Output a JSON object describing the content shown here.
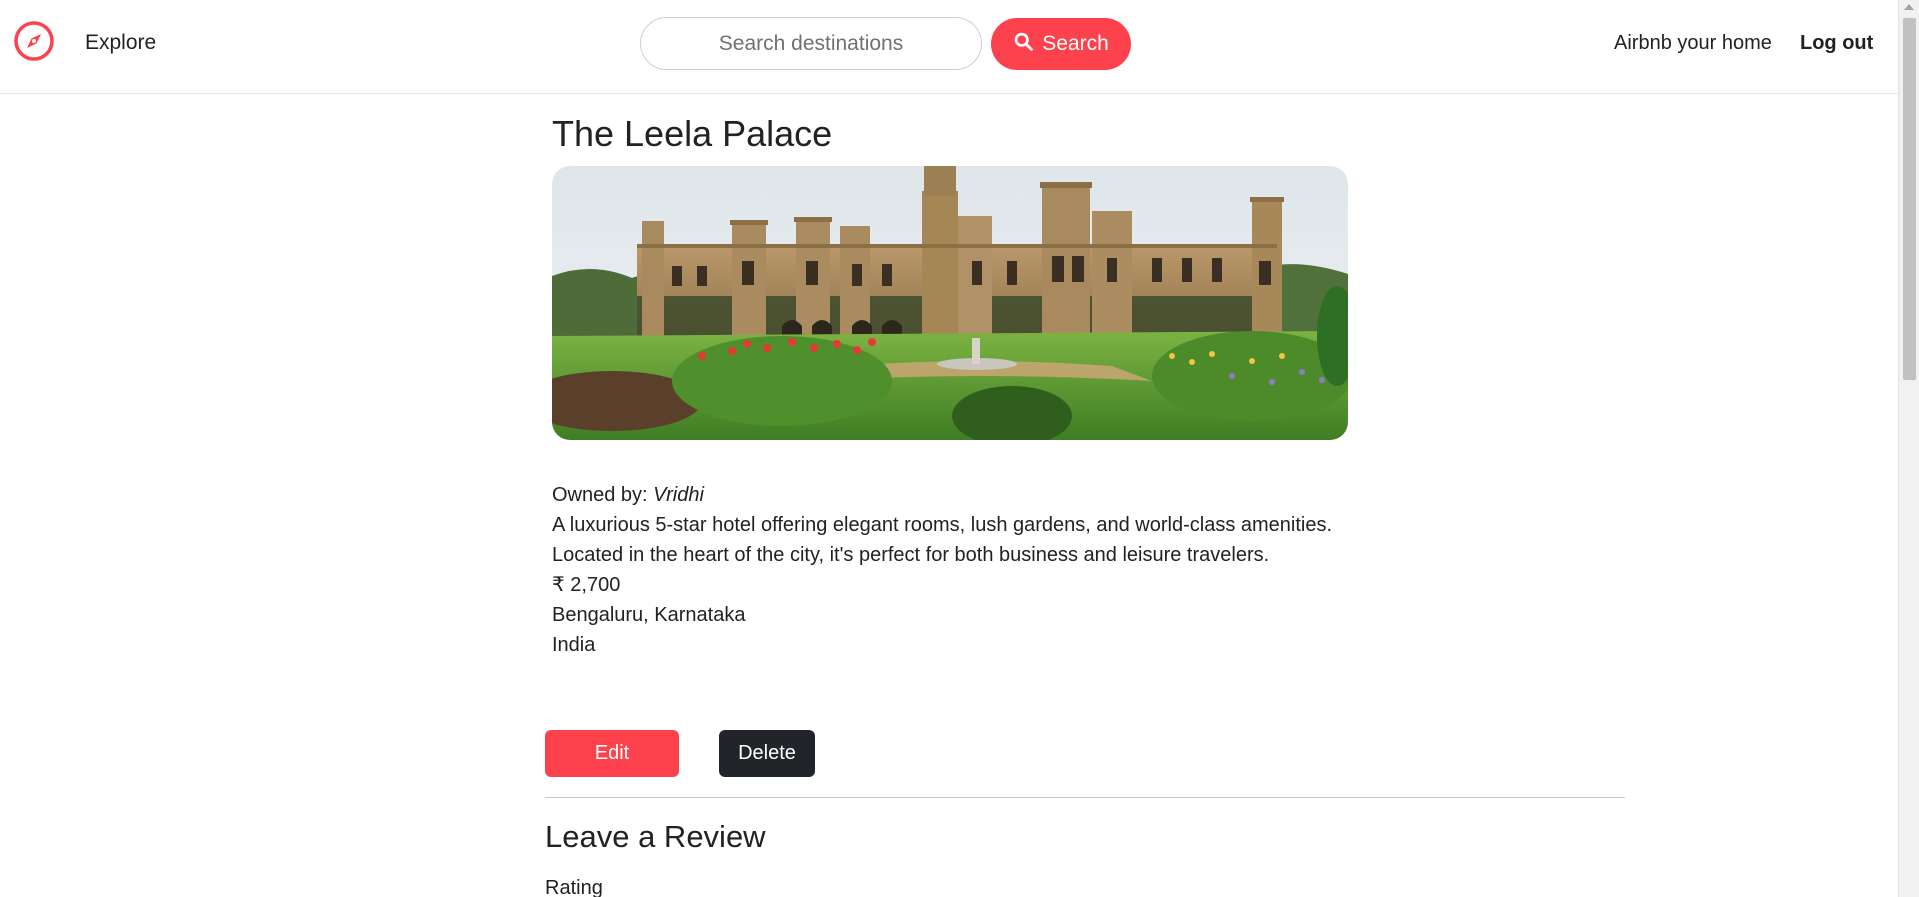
{
  "navbar": {
    "logo_icon": "compass-icon",
    "explore_label": "Explore",
    "search_placeholder": "Search destinations",
    "search_button_label": "Search",
    "search_icon": "search-icon",
    "host_label": "Airbnb your home",
    "logout_label": "Log out"
  },
  "listing": {
    "title": "The Leela Palace",
    "image_alt": "The Leela Palace",
    "owner_prefix": "Owned by:",
    "owner_name": "Vridhi",
    "description": "A luxurious 5-star hotel offering elegant rooms, lush gardens, and world-class amenities. Located in the heart of the city, it's perfect for both business and leisure travelers.",
    "price": "₹ 2,700",
    "location": "Bengaluru, Karnataka",
    "country": "India"
  },
  "actions": {
    "edit_label": "Edit",
    "delete_label": "Delete"
  },
  "review": {
    "heading": "Leave a Review",
    "rating_label": "Rating"
  },
  "colors": {
    "brand": "#fe424d",
    "dark_button": "#212529",
    "text": "#222222"
  }
}
